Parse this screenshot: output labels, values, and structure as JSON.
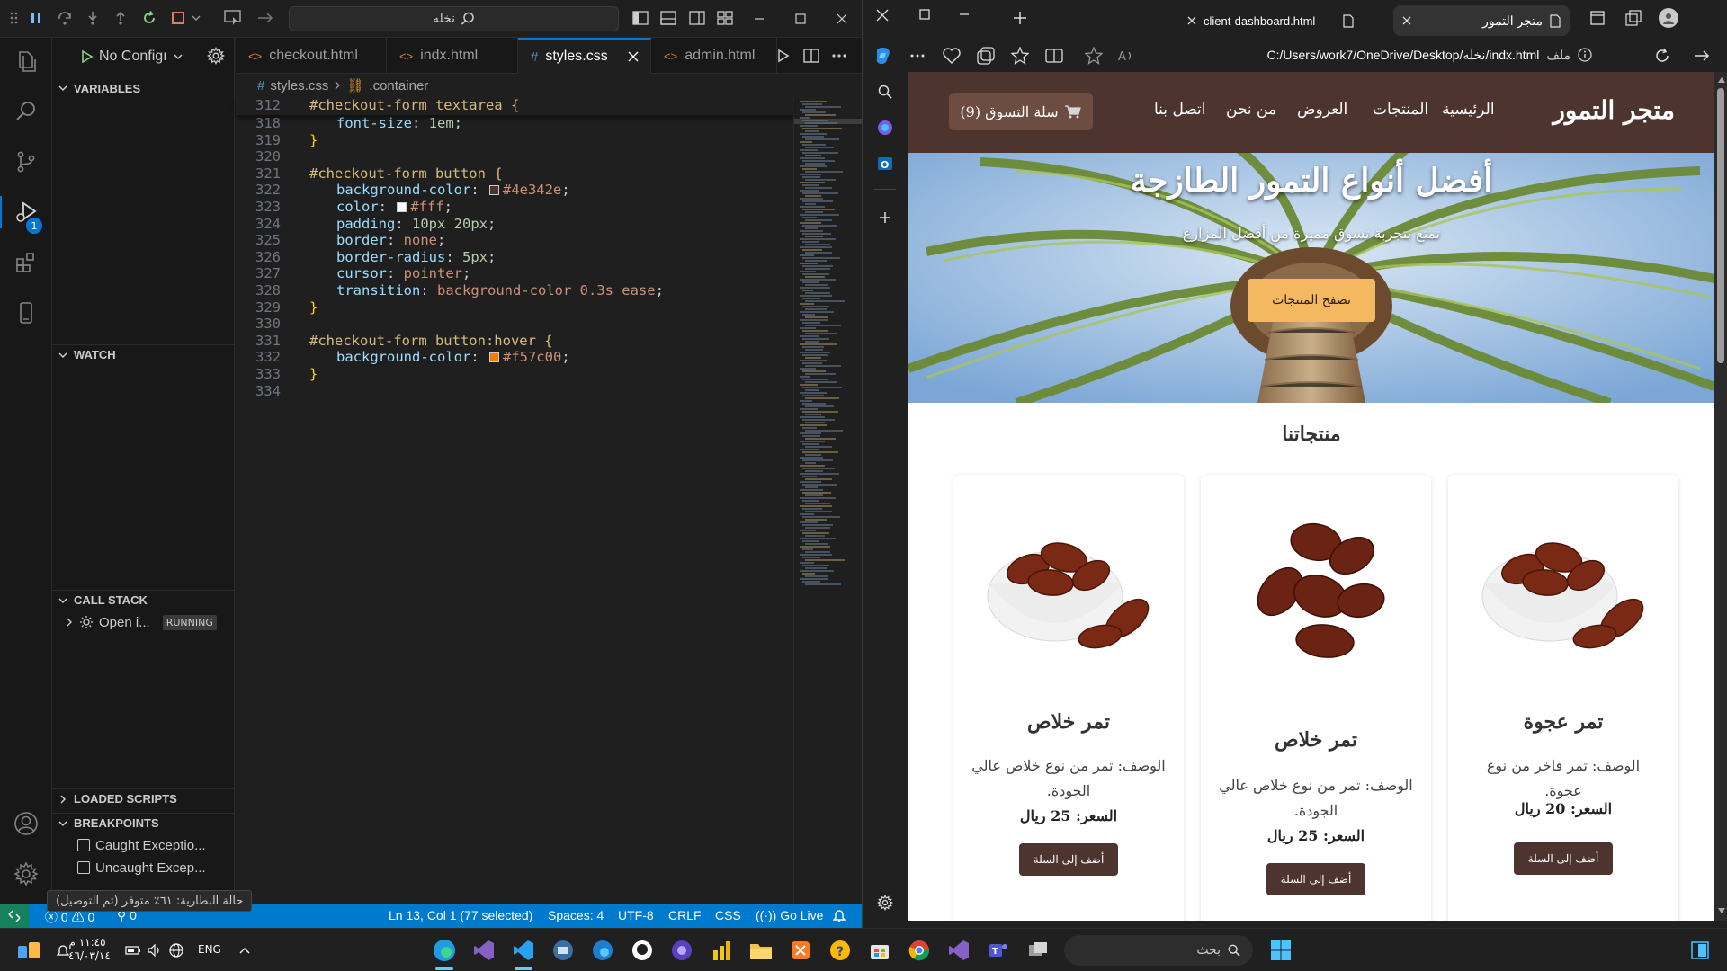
{
  "vscode": {
    "command_center": "نخله",
    "run_config": "No Configı",
    "sections": {
      "variables": "VARIABLES",
      "watch": "WATCH",
      "call_stack": "CALL STACK",
      "loaded_scripts": "LOADED SCRIPTS",
      "breakpoints": "BREAKPOINTS"
    },
    "call_stack_item": "Open i...",
    "call_stack_status": "RUNNING",
    "breakpoint_items": [
      "Caught Exceptio...",
      "Uncaught Excep..."
    ],
    "debug_badge": "1",
    "tabs": [
      {
        "label": "checkout.html",
        "icon": "<>"
      },
      {
        "label": "indx.html",
        "icon": "<>"
      },
      {
        "label": "styles.css",
        "icon": "#"
      },
      {
        "label": "admin.html",
        "icon": "<>"
      }
    ],
    "breadcrumb": {
      "file": "styles.css",
      "symbol": ".container"
    },
    "code": {
      "sticky_line": "312",
      "sticky_text": "#checkout-form textarea {",
      "lines": [
        {
          "n": "318",
          "prop": "font-size",
          "val": "1em"
        },
        {
          "n": "319",
          "text": "}"
        },
        {
          "n": "320",
          "text": ""
        },
        {
          "n": "321",
          "text": "#checkout-form button {"
        },
        {
          "n": "322",
          "prop": "background-color",
          "val": "#4e342e",
          "swatch": "#4e342e"
        },
        {
          "n": "323",
          "prop": "color",
          "val": "#fff",
          "swatch": "#ffffff"
        },
        {
          "n": "324",
          "prop": "padding",
          "val": "10px 20px"
        },
        {
          "n": "325",
          "prop": "border",
          "val": "none"
        },
        {
          "n": "326",
          "prop": "border-radius",
          "val": "5px"
        },
        {
          "n": "327",
          "prop": "cursor",
          "val": "pointer"
        },
        {
          "n": "328",
          "prop": "transition",
          "val": "background-color 0.3s ease"
        },
        {
          "n": "329",
          "text": "}"
        },
        {
          "n": "330",
          "text": ""
        },
        {
          "n": "331",
          "text": "#checkout-form button:hover {"
        },
        {
          "n": "332",
          "prop": "background-color",
          "val": "#f57c00",
          "swatch": "#f57c00"
        },
        {
          "n": "333",
          "text": "}"
        },
        {
          "n": "334",
          "text": ""
        }
      ]
    },
    "status": {
      "errors": "0",
      "warnings": "0",
      "ports": "0",
      "cursor": "Ln 13, Col 1 (77 selected)",
      "spaces": "Spaces: 4",
      "encoding": "UTF-8",
      "eol": "CRLF",
      "language": "CSS",
      "golive": "Go Live"
    },
    "tooltip": "حالة البطارية: ٦١٪ متوفر (تم التوصيل)"
  },
  "edge": {
    "tabs": [
      {
        "label": "client-dashboard.html"
      },
      {
        "label": "متجر التمور"
      }
    ],
    "address": "C:/Users/work7/OneDrive/Desktop/نخله/indx.html",
    "address_prefix": "ملف"
  },
  "site": {
    "logo": "متجر التمور",
    "nav": [
      "الرئيسية",
      "المنتجات",
      "العروض",
      "من نحن",
      "اتصل بنا"
    ],
    "cart": "سلة التسوق (9)",
    "hero_title": "أفضل أنواع التمور الطازجة",
    "hero_sub": "تمتع بتجربة تسوق مميزة من أفضل المزارع",
    "hero_btn": "تصفح المنتجات",
    "products_title": "منتجاتنا",
    "products": [
      {
        "name": "تمر عجوة",
        "desc": "الوصف: تمر فاخر من نوع عجوة.",
        "price": "السعر: 20 ريال",
        "btn": "أضف إلى السلة"
      },
      {
        "name": "تمر خلاص",
        "desc": "الوصف: تمر من نوع خلاص عالي الجودة.",
        "price": "السعر: 25 ريال",
        "btn": "أضف إلى السلة"
      },
      {
        "name": "تمر خلاص",
        "desc": "الوصف: تمر من نوع خلاص عالي الجودة.",
        "price": "السعر: 25 ريال",
        "btn": "أضف إلى السلة"
      }
    ]
  },
  "taskbar": {
    "time": "١١:٤٥ م",
    "date": "٤٦/٠٣/١٤",
    "lang": "ENG",
    "search": "بحث"
  },
  "colors": {
    "vs_bg": "#1f1f1f",
    "statusbar": "#007acc",
    "brand_brown": "#4e342e",
    "hero_button": "#f4b860"
  }
}
